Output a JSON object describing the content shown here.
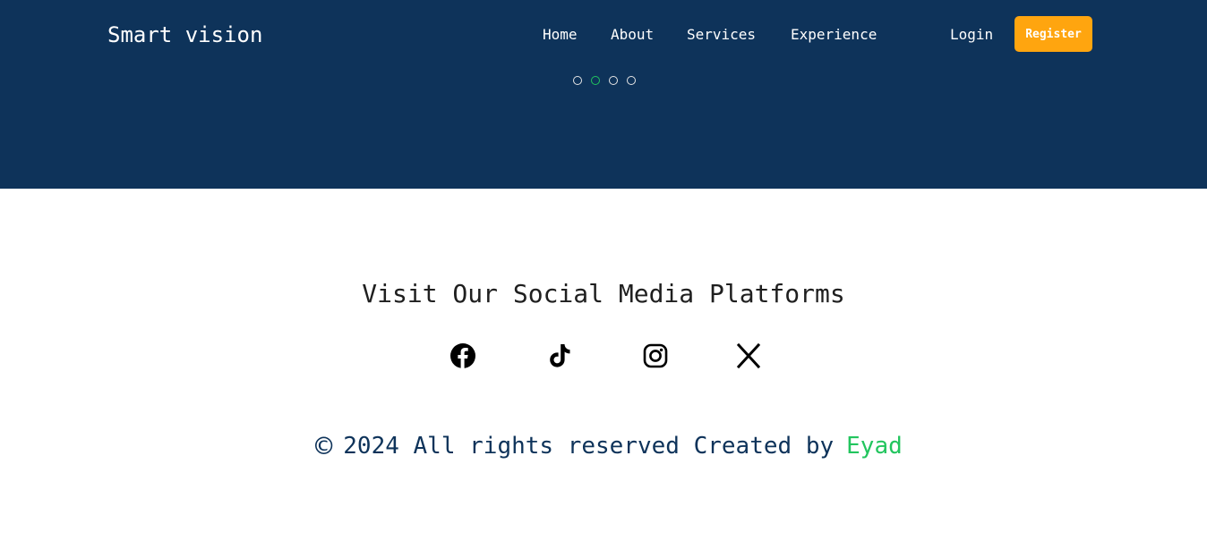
{
  "header": {
    "brand": "Smart vision",
    "nav": {
      "home": "Home",
      "about": "About",
      "services": "Services",
      "experience": "Experience",
      "login": "Login",
      "register": "Register"
    },
    "carousel": {
      "slide_count": 4,
      "active_index": 1
    }
  },
  "social": {
    "title": "Visit Our Social Media Platforms",
    "icons": [
      "facebook-icon",
      "tiktok-icon",
      "instagram-icon",
      "x-icon"
    ]
  },
  "footer": {
    "copyright_symbol": "©",
    "text": "2024 All rights reserved Created by",
    "author": "Eyad"
  },
  "colors": {
    "header_bg": "#0e335a",
    "register_bg": "#ffa50f",
    "accent_green": "#22c55e"
  }
}
